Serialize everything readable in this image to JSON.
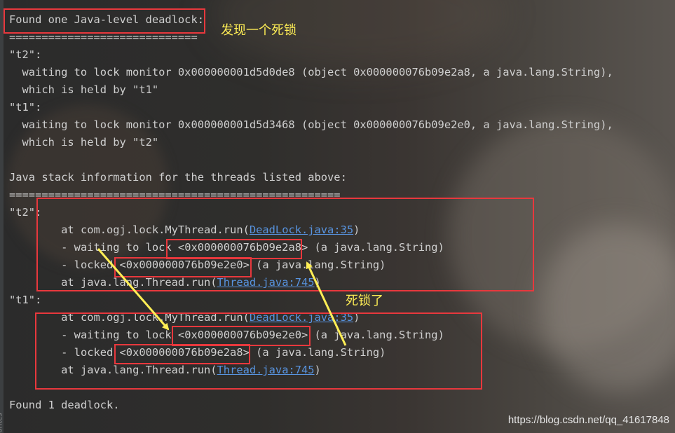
{
  "console": {
    "lines": [
      {
        "text": "Found one Java-level deadlock:"
      },
      {
        "text": "============================="
      },
      {
        "text": "\"t2\":"
      },
      {
        "text": "  waiting to lock monitor 0x000000001d5d0de8 (object 0x000000076b09e2a8, a java.lang.String),"
      },
      {
        "text": "  which is held by \"t1\""
      },
      {
        "text": "\"t1\":"
      },
      {
        "text": "  waiting to lock monitor 0x000000001d5d3468 (object 0x000000076b09e2e0, a java.lang.String),"
      },
      {
        "text": "  which is held by \"t2\""
      },
      {
        "text": ""
      },
      {
        "text": "Java stack information for the threads listed above:"
      },
      {
        "text": "==================================================="
      },
      {
        "text": "\"t2\":"
      },
      {
        "text": "\tat com.ogj.lock.MyThread.run(",
        "link": "DeadLock.java:35",
        "suffix": ")"
      },
      {
        "text": "\t- waiting to lock <0x000000076b09e2a8> (a java.lang.String)"
      },
      {
        "text": "\t- locked <0x000000076b09e2e0> (a java.lang.String)"
      },
      {
        "text": "\tat java.lang.Thread.run(",
        "link": "Thread.java:745",
        "suffix": ")"
      },
      {
        "text": "\"t1\":"
      },
      {
        "text": "\tat com.ogj.lock.MyThread.run(",
        "link": "DeadLock.java:35",
        "suffix": ")"
      },
      {
        "text": "\t- waiting to lock <0x000000076b09e2e0> (a java.lang.String)"
      },
      {
        "text": "\t- locked <0x000000076b09e2a8> (a java.lang.String)"
      },
      {
        "text": "\tat java.lang.Thread.run(",
        "link": "Thread.java:745",
        "suffix": ")"
      },
      {
        "text": ""
      },
      {
        "text": "Found 1 deadlock."
      }
    ]
  },
  "annotations": {
    "found_deadlock": "发现一个死锁",
    "deadlocked": "死锁了"
  },
  "watermark": "https://blog.csdn.net/qq_41617848",
  "sidebar_tab": "orites",
  "colors": {
    "text": "#cfcfcf",
    "link": "#5894e0",
    "highlight_box": "#e8383d",
    "annotation": "#ffee55"
  }
}
